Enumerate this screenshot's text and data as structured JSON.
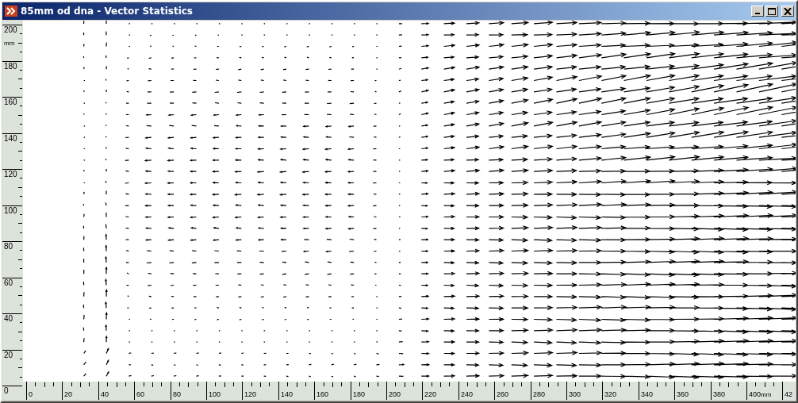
{
  "window": {
    "title": "85mm od dna - Vector Statistics"
  },
  "y_ruler": {
    "unit": "mm",
    "labels": [
      "200",
      "180",
      "160",
      "140",
      "120",
      "100",
      "80",
      "60",
      "40",
      "20",
      "0"
    ]
  },
  "x_ruler": {
    "unit": "mm",
    "labels": [
      "0",
      "20",
      "40",
      "60",
      "80",
      "100",
      "120",
      "140",
      "160",
      "180",
      "200",
      "220",
      "240",
      "260",
      "280",
      "300",
      "320",
      "340",
      "360",
      "380",
      "400",
      "42"
    ]
  }
}
